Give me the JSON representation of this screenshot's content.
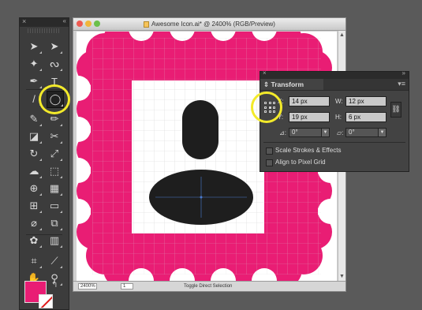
{
  "tools_panel": {
    "close_glyph": "×",
    "collapse_glyph": "«",
    "tools": [
      {
        "name": "selection-tool",
        "glyph": "➤",
        "active": false
      },
      {
        "name": "direct-selection-tool",
        "glyph": "➤",
        "active": false
      },
      {
        "name": "magic-wand-tool",
        "glyph": "✦",
        "active": false
      },
      {
        "name": "lasso-tool",
        "glyph": "ᔓ",
        "active": false
      },
      {
        "name": "pen-tool",
        "glyph": "✒",
        "active": false
      },
      {
        "name": "type-tool",
        "glyph": "T",
        "active": false
      },
      {
        "name": "line-segment-tool",
        "glyph": "/",
        "active": false
      },
      {
        "name": "ellipse-tool",
        "glyph": "◯",
        "active": true
      },
      {
        "name": "paintbrush-tool",
        "glyph": "✎",
        "active": false
      },
      {
        "name": "pencil-tool",
        "glyph": "✏",
        "active": false
      },
      {
        "name": "eraser-tool",
        "glyph": "◪",
        "active": false
      },
      {
        "name": "scissors-tool",
        "glyph": "✂",
        "active": false
      },
      {
        "name": "rotate-tool",
        "glyph": "↻",
        "active": false
      },
      {
        "name": "scale-tool",
        "glyph": "⤢",
        "active": false
      },
      {
        "name": "warp-tool",
        "glyph": "☁",
        "active": false
      },
      {
        "name": "free-transform-tool",
        "glyph": "⬚",
        "active": false
      },
      {
        "name": "shape-builder-tool",
        "glyph": "⊕",
        "active": false
      },
      {
        "name": "perspective-grid-tool",
        "glyph": "▦",
        "active": false
      },
      {
        "name": "mesh-tool",
        "glyph": "⊞",
        "active": false
      },
      {
        "name": "gradient-tool",
        "glyph": "▭",
        "active": false
      },
      {
        "name": "eyedropper-tool",
        "glyph": "⌀",
        "active": false
      },
      {
        "name": "blend-tool",
        "glyph": "⧉",
        "active": false
      },
      {
        "name": "symbol-sprayer-tool",
        "glyph": "✿",
        "active": false
      },
      {
        "name": "column-graph-tool",
        "glyph": "▥",
        "active": false
      },
      {
        "name": "artboard-tool",
        "glyph": "⌗",
        "active": false
      },
      {
        "name": "slice-tool",
        "glyph": "⟋",
        "active": false
      },
      {
        "name": "hand-tool",
        "glyph": "✋",
        "active": false
      },
      {
        "name": "zoom-tool",
        "glyph": "⚲",
        "active": false
      }
    ],
    "fill_color": "#e91d74",
    "stroke_color": "#ffffff",
    "swap_glyph": "↰"
  },
  "document": {
    "title": "Awesome Icon.ai* @ 2400% (RGB/Preview)",
    "zoom": "2400%",
    "artboard_number": "1",
    "status_text": "Toggle Direct Selection",
    "frame_color": "#e91d74",
    "shape_color": "#1e1e1e"
  },
  "transform_panel": {
    "tab_label": "Transform",
    "x_label": "X:",
    "x_value": "14 px",
    "y_label": "Y:",
    "y_value": "19 px",
    "w_label": "W:",
    "w_value": "12 px",
    "h_label": "H:",
    "h_value": "6 px",
    "rotate_value": "0°",
    "shear_value": "0°",
    "scale_strokes_label": "Scale Strokes & Effects",
    "align_pixel_grid_label": "Align to Pixel Grid",
    "scale_strokes_checked": false,
    "align_pixel_grid_checked": false
  },
  "highlight_color": "#f3ea2a"
}
